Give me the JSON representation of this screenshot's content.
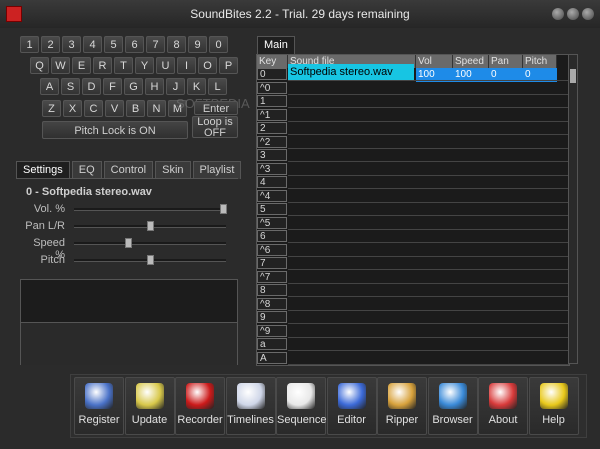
{
  "window": {
    "title": "SoundBites 2.2 - Trial. 29 days remaining"
  },
  "keyboard": {
    "row1": [
      "1",
      "2",
      "3",
      "4",
      "5",
      "6",
      "7",
      "8",
      "9",
      "0"
    ],
    "row2": [
      "Q",
      "W",
      "E",
      "R",
      "T",
      "Y",
      "U",
      "I",
      "O",
      "P"
    ],
    "row3": [
      "A",
      "S",
      "D",
      "F",
      "G",
      "H",
      "J",
      "K",
      "L"
    ],
    "row4": [
      "Z",
      "X",
      "C",
      "V",
      "B",
      "N",
      "M"
    ],
    "enter_label": "Enter",
    "pitch_lock": "Pitch Lock is ON",
    "loop": "Loop is OFF"
  },
  "watermark": "SOFTPEDIA",
  "tabs": [
    "Settings",
    "EQ",
    "Control",
    "Skin",
    "Playlist"
  ],
  "settings": {
    "sound_name": "0 - Softpedia stereo.wav",
    "sliders": [
      {
        "label": "Vol. %",
        "value": 100
      },
      {
        "label": "Pan L/R",
        "value": 50
      },
      {
        "label": "Speed %",
        "value": 35
      },
      {
        "label": "Pitch",
        "value": 50
      }
    ]
  },
  "main": {
    "tab": "Main",
    "columns": [
      "Key",
      "Sound file",
      "Vol",
      "Speed",
      "Pan",
      "Pitch"
    ],
    "keys": [
      "0",
      "^0",
      "1",
      "^1",
      "2",
      "^2",
      "3",
      "^3",
      "4",
      "^4",
      "5",
      "^5",
      "6",
      "^6",
      "7",
      "^7",
      "8",
      "^8",
      "9",
      "^9",
      "a",
      "A"
    ],
    "selected_row": {
      "file": "Softpedia stereo.wav",
      "vol": "100",
      "speed": "100",
      "pan": "0",
      "pitch": "0"
    }
  },
  "toolbar": [
    {
      "label": "Register",
      "icon": "register-icon",
      "color": "#4a72c8"
    },
    {
      "label": "Update",
      "icon": "update-icon",
      "color": "#d8c84a"
    },
    {
      "label": "Recorder",
      "icon": "recorder-icon",
      "color": "#cc1a1a"
    },
    {
      "label": "Timelines",
      "icon": "clock-icon",
      "color": "#cfd6e8"
    },
    {
      "label": "Sequence",
      "icon": "sequence-icon",
      "color": "#e8e8e8"
    },
    {
      "label": "Editor",
      "icon": "editor-icon",
      "color": "#3c6ad8"
    },
    {
      "label": "Ripper",
      "icon": "disc-icon",
      "color": "#d8a23c"
    },
    {
      "label": "Browser",
      "icon": "www-icon",
      "color": "#3a8ad8"
    },
    {
      "label": "About",
      "icon": "mouth-icon",
      "color": "#d83a3a"
    },
    {
      "label": "Help",
      "icon": "help-icon",
      "color": "#e8c81a"
    }
  ]
}
